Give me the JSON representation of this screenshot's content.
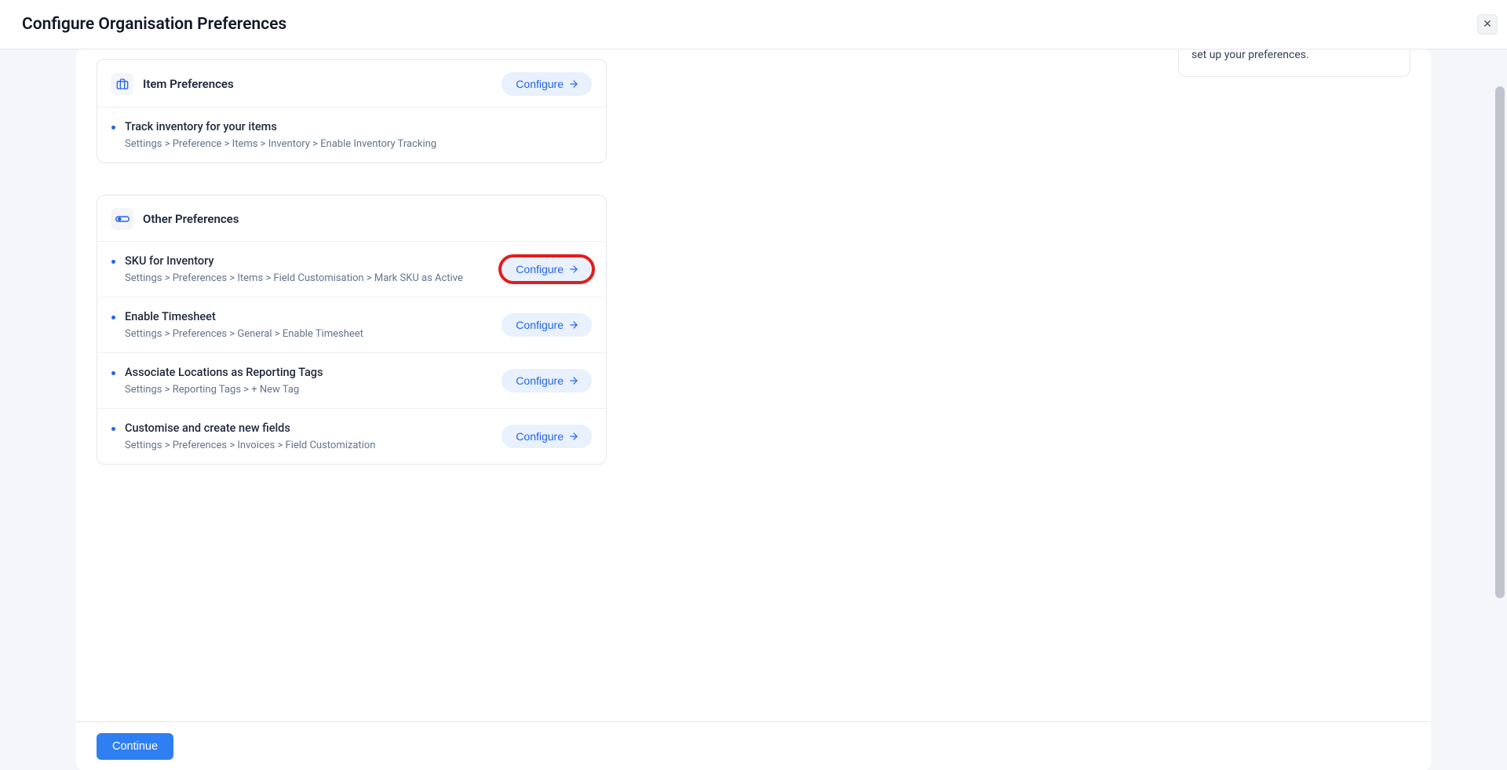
{
  "header": {
    "title": "Configure Organisation Preferences",
    "close_label": "✕"
  },
  "info_panel": {
    "text_fragment": "can navigate to the desired setting and set up your preferences."
  },
  "item_card": {
    "title": "Item Preferences",
    "configure_label": "Configure",
    "rows": [
      {
        "title": "Track inventory for your items",
        "path": "Settings > Preference > Items > Inventory > Enable Inventory Tracking"
      }
    ]
  },
  "other_card": {
    "title": "Other Preferences",
    "configure_label": "Configure",
    "rows": [
      {
        "title": "SKU for Inventory",
        "path": "Settings > Preferences > Items > Field Customisation > Mark SKU as Active",
        "highlight": true
      },
      {
        "title": "Enable Timesheet",
        "path": "Settings > Preferences > General > Enable Timesheet"
      },
      {
        "title": "Associate Locations as Reporting Tags",
        "path": "Settings > Reporting Tags > + New Tag"
      },
      {
        "title": "Customise and create new fields",
        "path": "Settings > Preferences > Invoices > Field Customization"
      }
    ]
  },
  "footer": {
    "continue_label": "Continue"
  }
}
